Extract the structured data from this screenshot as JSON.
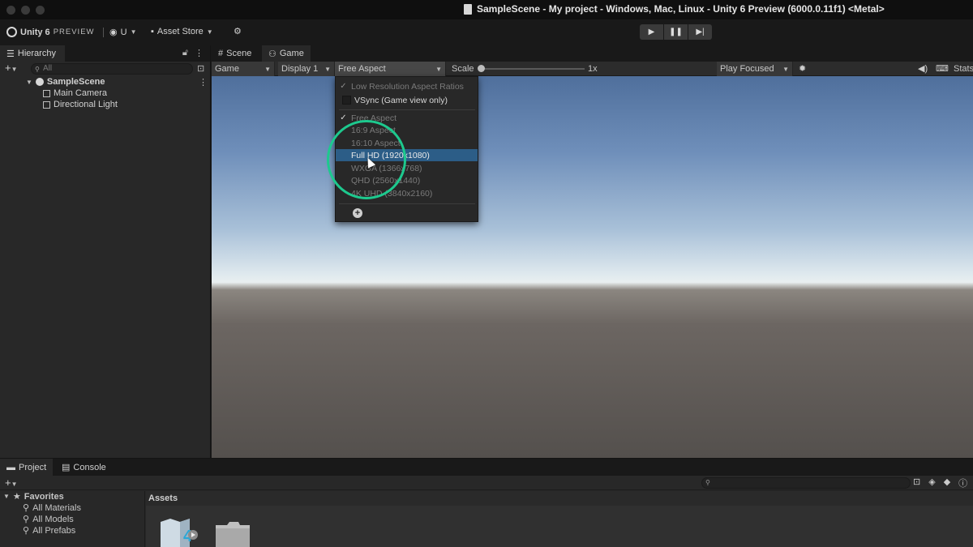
{
  "window": {
    "title": "SampleScene - My project - Windows, Mac, Linux - Unity 6 Preview (6000.0.11f1) <Metal>"
  },
  "toolbar": {
    "product": "Unity 6",
    "preview": "PREVIEW",
    "account_label": "U",
    "asset_store": "Asset Store"
  },
  "hierarchy": {
    "tab_label": "Hierarchy",
    "search_placeholder": "All",
    "scene": "SampleScene",
    "items": [
      "Main Camera",
      "Directional Light"
    ]
  },
  "game_view": {
    "tabs": [
      "Scene",
      "Game"
    ],
    "active_tab": "Game",
    "view_dropdown": "Game",
    "display_dropdown": "Display 1",
    "aspect_dropdown": "Free Aspect",
    "scale_label": "Scale",
    "scale_value": "1x",
    "play_mode_dropdown": "Play Focused",
    "stats_label": "Stats"
  },
  "aspect_menu": {
    "low_res": "Low Resolution Aspect Ratios",
    "vsync": "VSync (Game view only)",
    "options": [
      "Free Aspect",
      "16:9 Aspect",
      "16:10 Aspect",
      "Full HD (1920x1080)",
      "WXGA (1366x768)",
      "QHD (2560x1440)",
      "4K UHD (3840x2160)"
    ],
    "checked_option": "Free Aspect",
    "highlighted_option": "Full HD (1920x1080)"
  },
  "project": {
    "tabs": [
      "Project",
      "Console"
    ],
    "favorites_label": "Favorites",
    "favorites": [
      "All Materials",
      "All Models",
      "All Prefabs"
    ],
    "assets_label": "Assets"
  },
  "colors": {
    "highlight": "#2c5d87",
    "cursor_ring": "#1dc98e"
  }
}
